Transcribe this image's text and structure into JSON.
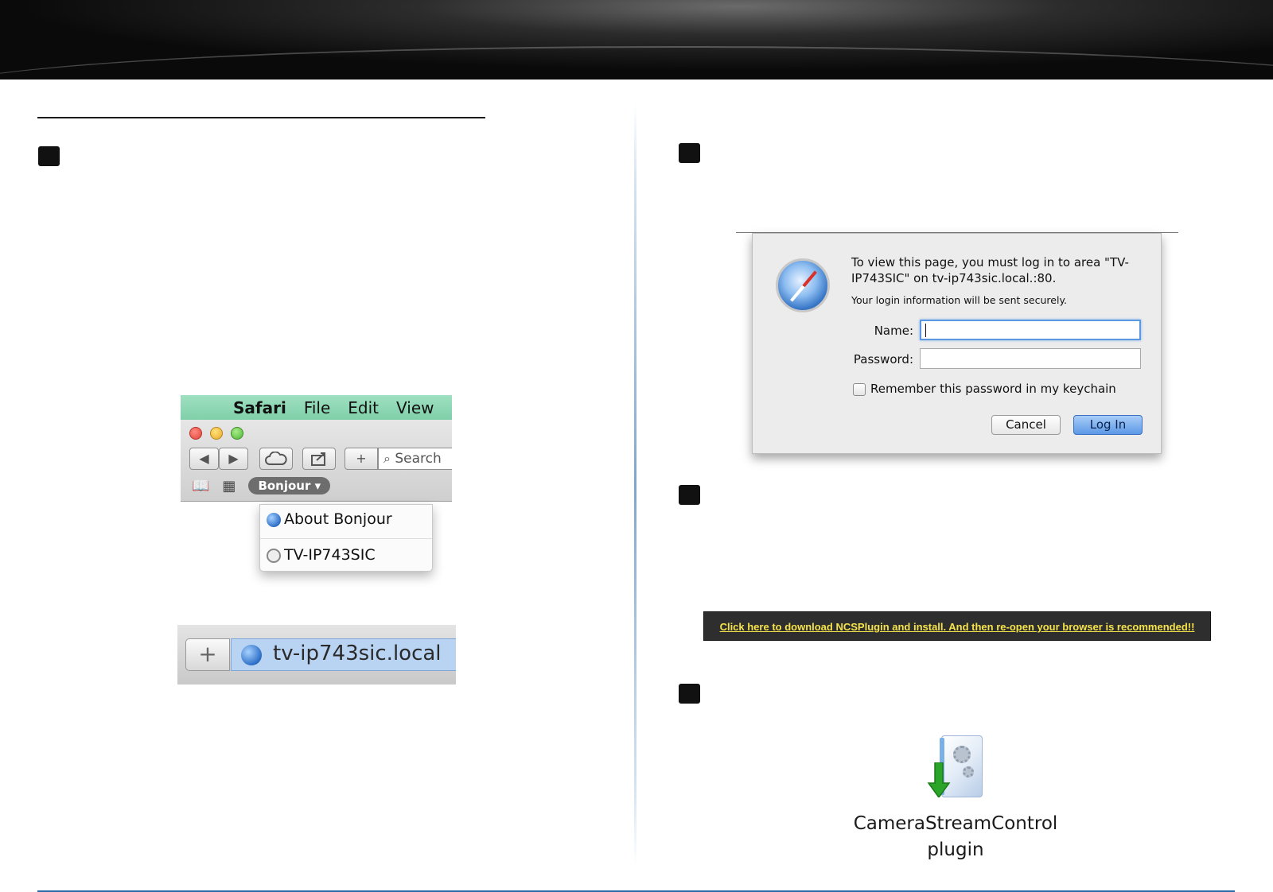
{
  "safari_menu": {
    "menubar": {
      "app": "Safari",
      "file": "File",
      "edit": "Edit",
      "view": "View"
    },
    "toolbar": {
      "back": "◀",
      "forward": "▶",
      "new_tab": "+",
      "search_placeholder": "Search"
    },
    "bookmarks": {
      "bonjour_label": "Bonjour ▾"
    },
    "bonjour_dropdown": {
      "items": [
        "About Bonjour",
        "TV-IP743SIC"
      ]
    }
  },
  "address_bar": {
    "plus": "+",
    "url": "tv-ip743sic.local"
  },
  "login_dialog": {
    "message": "To view this page, you must log in to area \"TV-IP743SIC\" on tv-ip743sic.local.:80.",
    "secure_note": "Your login information will be sent securely.",
    "name_label": "Name:",
    "password_label": "Password:",
    "remember_label": "Remember this password in my keychain",
    "cancel_label": "Cancel",
    "login_label": "Log In",
    "name_value": "",
    "password_value": ""
  },
  "plugin_banner": {
    "link_text": "Click here to download NCSPlugin and install. And then re-open your browser is recommended!!"
  },
  "plugin_icon": {
    "label_line1": "CameraStreamControl",
    "label_line2": "plugin"
  },
  "colors": {
    "accent_blue": "#2b6aa8",
    "menubar_green": "#8fd8b6",
    "link_yellow": "#f5e34a"
  }
}
